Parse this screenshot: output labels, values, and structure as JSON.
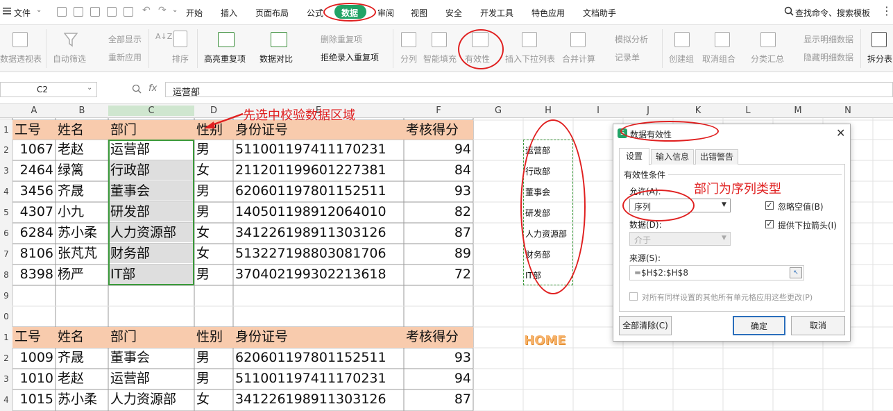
{
  "menubar": {
    "file": "文件",
    "tabs": [
      "开始",
      "插入",
      "页面布局",
      "公式",
      "数据",
      "审阅",
      "视图",
      "安全",
      "开发工具",
      "特色应用",
      "文档助手"
    ],
    "search": "查找命令、搜索模板"
  },
  "ribbon": {
    "pivot": "数据透视表",
    "autofilter": "自动筛选",
    "showall": "全部显示",
    "reapply": "重新应用",
    "sort": "排序",
    "highlight_dup": "高亮重复项",
    "compare": "数据对比",
    "del_dup": "删除重复项",
    "reject_dup": "拒绝录入重复项",
    "split": "分列",
    "smartfill": "智能填充",
    "validity": "有效性",
    "insert_dropdown": "插入下拉列表",
    "merge_calc": "合并计算",
    "simulate": "模拟分析",
    "record": "记录单",
    "create_group": "创建组",
    "ungroup": "取消组合",
    "subtotal": "分类汇总",
    "show_detail": "显示明细数据",
    "hide_detail": "隐藏明细数据",
    "split_table": "拆分表"
  },
  "formula_bar": {
    "namebox": "C2",
    "fx": "fx",
    "value": "运营部"
  },
  "columns": [
    "A",
    "B",
    "C",
    "D",
    "E",
    "F",
    "G",
    "H",
    "I",
    "J",
    "K",
    "L",
    "M",
    "N"
  ],
  "rows_top": [
    "1",
    "2",
    "3",
    "4",
    "5",
    "6",
    "7",
    "8",
    "9",
    "0"
  ],
  "rows_bottom": [
    "1",
    "2",
    "3",
    "4"
  ],
  "table1": {
    "headers": [
      "工号",
      "姓名",
      "部门",
      "性别",
      "身份证号",
      "考核得分"
    ],
    "rows": [
      [
        "1067",
        "老赵",
        "运营部",
        "男",
        "511001197411170231",
        "94"
      ],
      [
        "2464",
        "绿篱",
        "行政部",
        "女",
        "211201199601227381",
        "84"
      ],
      [
        "3456",
        "齐晟",
        "董事会",
        "男",
        "620601197801152511",
        "93"
      ],
      [
        "4307",
        "小九",
        "研发部",
        "男",
        "140501198912064010",
        "82"
      ],
      [
        "6284",
        "苏小柔",
        "人力资源部",
        "女",
        "341226198911303126",
        "87"
      ],
      [
        "8106",
        "张芃芃",
        "财务部",
        "女",
        "513227198803081706",
        "89"
      ],
      [
        "8398",
        "杨严",
        "IT部",
        "男",
        "370402199302213618",
        "72"
      ]
    ]
  },
  "table2": {
    "headers": [
      "工号",
      "姓名",
      "部门",
      "性别",
      "身份证号",
      "考核得分"
    ],
    "rows": [
      [
        "1009",
        "齐晟",
        "董事会",
        "男",
        "620601197801152511",
        "93"
      ],
      [
        "1010",
        "老赵",
        "运营部",
        "男",
        "511001197411170231",
        "94"
      ],
      [
        "1015",
        "苏小柔",
        "人力资源部",
        "女",
        "341226198911303126",
        "87"
      ]
    ]
  },
  "h_list": [
    "运营部",
    "行政部",
    "董事会",
    "研发部",
    "人力资源部",
    "财务部",
    "IT部"
  ],
  "home_label": "HOME",
  "annotations": {
    "select_area": "先选中校验数据区域",
    "sequence_type": "部门为序列类型"
  },
  "dialog": {
    "title": "数据有效性",
    "tabs": [
      "设置",
      "输入信息",
      "出错警告"
    ],
    "section": "有效性条件",
    "allow_label": "允许(A):",
    "allow_value": "序列",
    "ignore_blank": "忽略空值(B)",
    "dropdown_arrow": "提供下拉箭头(I)",
    "data_label": "数据(D):",
    "data_value": "介于",
    "source_label": "来源(S):",
    "source_value": "=$H$2:$H$8",
    "apply_all": "对所有同样设置的其他所有单元格应用这些更改(P)",
    "clear_all": "全部清除(C)",
    "ok": "确定",
    "cancel": "取消"
  },
  "colors": {
    "header_fill": "#f8cbad",
    "accent_green": "#21a366",
    "annotation_red": "#e02020",
    "selection_green": "#3a9a3a"
  }
}
